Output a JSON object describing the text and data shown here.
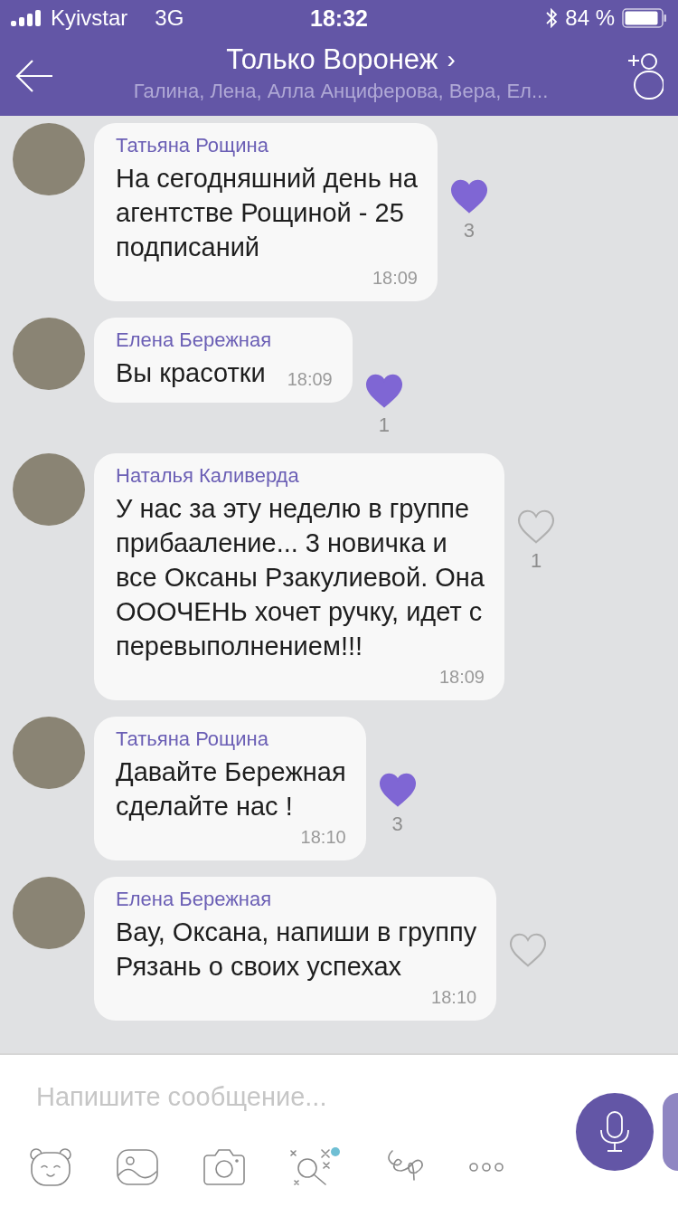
{
  "status_bar": {
    "carrier": "Kyivstar",
    "network": "3G",
    "time": "18:32",
    "battery": "84 %"
  },
  "header": {
    "title": "Только Воронеж",
    "chevron": "›",
    "members": "Галина, Лена, Алла Анциферова, Вера, Ел..."
  },
  "messages": [
    {
      "kind": "block",
      "sender": "Татьяна Рощина",
      "text": "На сегодняшний день на\nагентстве Рощиной - 25\nподписаний",
      "time": "18:09",
      "liked": true,
      "likes": "3"
    },
    {
      "kind": "inline",
      "sender": "Елена Бережная",
      "text": "Вы красотки",
      "time": "18:09",
      "liked": true,
      "likes": "1"
    },
    {
      "kind": "block",
      "sender": "Наталья Каливерда",
      "text": "У нас за эту неделю в группе\nприбааление... 3 новичка и\nвсе Оксаны Рзакулиевой. Она\nОООЧЕНЬ хочет ручку, идет с\nперевыполнением!!!",
      "time": "18:09",
      "liked": false,
      "likes": "1"
    },
    {
      "kind": "block",
      "sender": "Татьяна Рощина",
      "text": "Давайте Бережная\nсделайте нас !",
      "time": "18:10",
      "liked": true,
      "likes": "3"
    },
    {
      "kind": "block",
      "sender": "Елена Бережная",
      "text": "Вау, Оксана, напиши в группу\nРязань о своих успехах",
      "time": "18:10",
      "liked": false
    }
  ],
  "composer": {
    "placeholder": "Напишите сообщение...",
    "search_badge": true
  }
}
